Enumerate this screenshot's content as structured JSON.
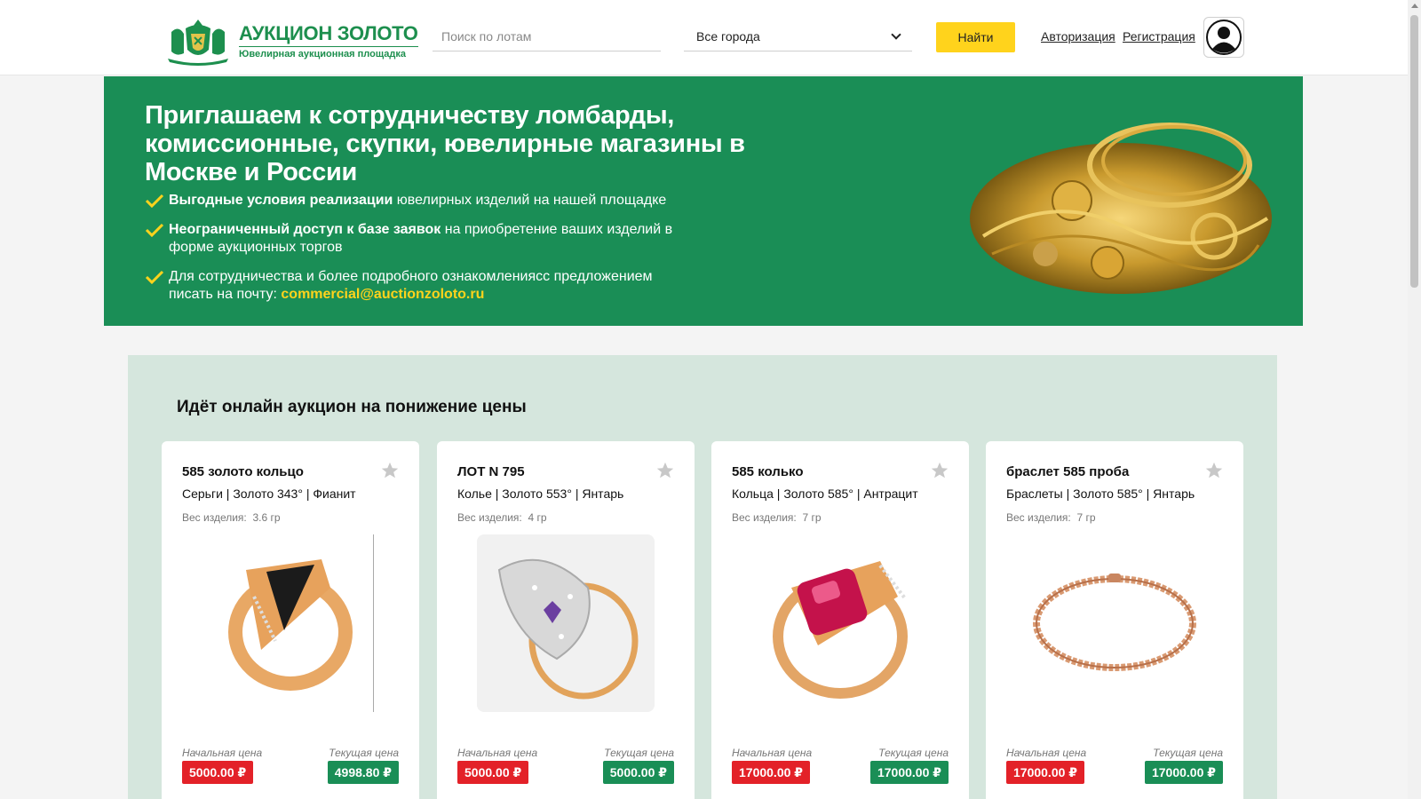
{
  "header": {
    "logo_title": "АУКЦИОН ЗОЛОТО",
    "logo_subtitle": "Ювелирная аукционная площадка",
    "search_placeholder": "Поиск по лотам",
    "city_selected": "Все города",
    "find_button": "Найти",
    "login_link": "Авторизация",
    "register_link": "Регистрация"
  },
  "banner": {
    "title": "Приглашаем к сотрудничеству ломбарды, комиссионные, скупки, ювелирные магазины в Москве и России",
    "bullet1_bold": "Выгодные условия реализации",
    "bullet1_rest": " ювелирных изделий на нашей площадке",
    "bullet2_bold": "Неограниченный доступ к базе заявок",
    "bullet2_rest": " на приобретение ваших изделий в форме аукционных торгов",
    "bullet3_text": "Для сотрудничества и более подробного ознакомлениясс предложением писать на почту: ",
    "bullet3_email": "commercial@auctionzoloto.ru"
  },
  "auction": {
    "title": "Идёт онлайн аукцион на понижение цены",
    "weight_label": "Вес изделия:",
    "start_price_label": "Начальная цена",
    "current_price_label": "Текущая цена",
    "cards": [
      {
        "title": "585 золото кольцо",
        "props": "Серьги | Золото 343° | Фианит",
        "weight": "3.6 гр",
        "start_price": "5000.00 ₽",
        "current_price": "4998.80 ₽"
      },
      {
        "title": "ЛОТ N 795",
        "props": "Колье | Золото 553° | Янтарь",
        "weight": "4 гр",
        "start_price": "5000.00 ₽",
        "current_price": "5000.00 ₽"
      },
      {
        "title": "585 колько",
        "props": "Кольца | Золото 585° | Антрацит",
        "weight": "7 гр",
        "start_price": "17000.00 ₽",
        "current_price": "17000.00 ₽"
      },
      {
        "title": "браслет 585 проба",
        "props": "Браслеты | Золото 585° | Янтарь",
        "weight": "7 гр",
        "start_price": "17000.00 ₽",
        "current_price": "17000.00 ₽"
      }
    ]
  },
  "colors": {
    "brand_green": "#1a8e56",
    "accent_yellow": "#ffd31c",
    "price_red": "#e32128",
    "section_bg": "#d5e6dd"
  }
}
